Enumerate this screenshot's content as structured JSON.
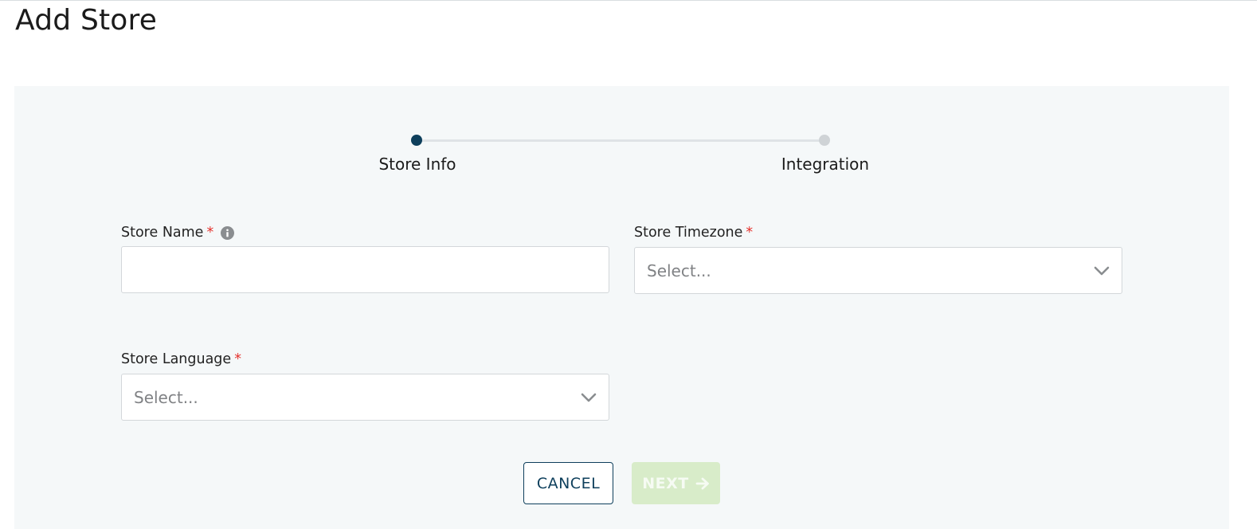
{
  "page": {
    "title": "Add Store"
  },
  "stepper": {
    "steps": [
      {
        "label": "Store Info",
        "state": "active"
      },
      {
        "label": "Integration",
        "state": "inactive"
      }
    ]
  },
  "form": {
    "store_name": {
      "label": "Store Name",
      "required_mark": "*",
      "value": "",
      "info_icon": "info-icon"
    },
    "store_timezone": {
      "label": "Store Timezone",
      "required_mark": "*",
      "placeholder": "Select..."
    },
    "store_language": {
      "label": "Store Language",
      "required_mark": "*",
      "placeholder": "Select..."
    }
  },
  "actions": {
    "cancel_label": "CANCEL",
    "next_label": "NEXT",
    "next_enabled": false
  },
  "colors": {
    "primary": "#0e3f5c",
    "required": "#e5322d",
    "next_disabled_bg": "#d8ecc9",
    "panel_bg": "#f5f8f9"
  }
}
